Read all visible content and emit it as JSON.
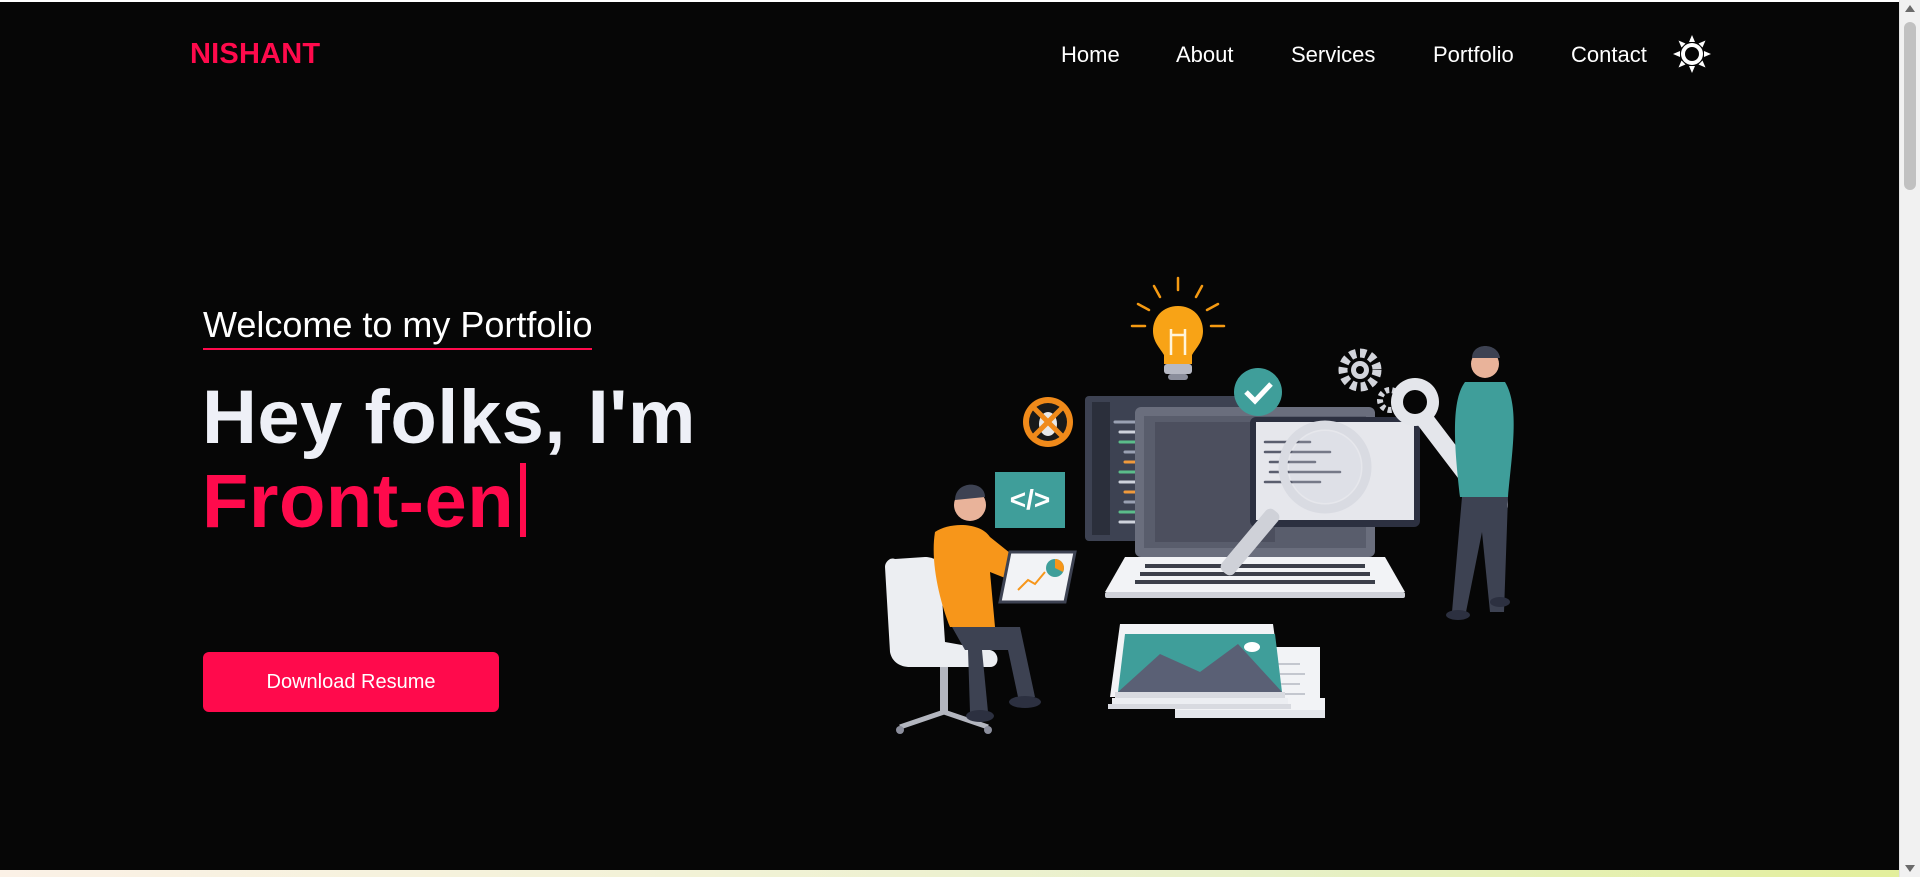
{
  "brand": {
    "logo": "NISHANT",
    "accent_color": "#ff0a4c"
  },
  "nav": {
    "items": [
      {
        "label": "Home"
      },
      {
        "label": "About"
      },
      {
        "label": "Services"
      },
      {
        "label": "Portfolio"
      },
      {
        "label": "Contact"
      }
    ],
    "theme_toggle_icon": "sun-icon"
  },
  "hero": {
    "welcome": "Welcome to my Portfolio",
    "title": "Hey folks, I'm",
    "typed_text": "Front-en",
    "button_label": "Download Resume"
  },
  "illustration": {
    "code_tag": "</>"
  }
}
